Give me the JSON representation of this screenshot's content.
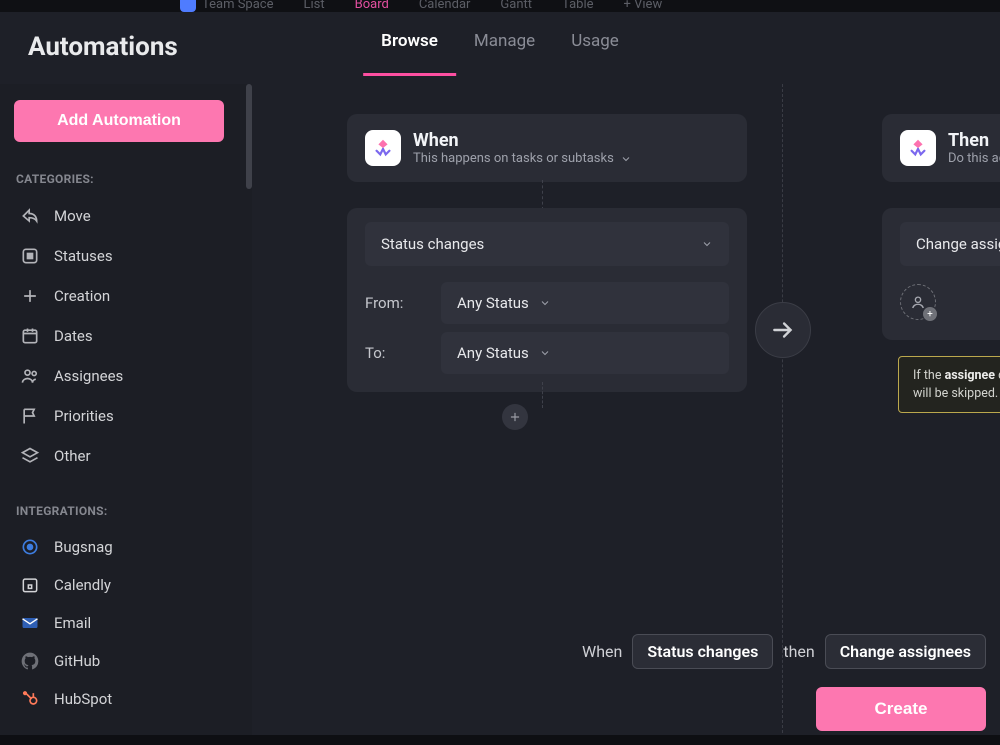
{
  "topbar": {
    "space": "Team Space",
    "views": [
      "List",
      "Board",
      "Calendar",
      "Gantt",
      "Table"
    ],
    "add_view": "+ View"
  },
  "page": {
    "title": "Automations"
  },
  "tabs": [
    {
      "label": "Browse",
      "active": true
    },
    {
      "label": "Manage",
      "active": false
    },
    {
      "label": "Usage",
      "active": false
    }
  ],
  "sidebar": {
    "add_label": "Add Automation",
    "categories_label": "CATEGORIES:",
    "categories": [
      {
        "label": "Move"
      },
      {
        "label": "Statuses"
      },
      {
        "label": "Creation"
      },
      {
        "label": "Dates"
      },
      {
        "label": "Assignees"
      },
      {
        "label": "Priorities"
      },
      {
        "label": "Other"
      }
    ],
    "integrations_label": "INTEGRATIONS:",
    "integrations": [
      {
        "label": "Bugsnag"
      },
      {
        "label": "Calendly"
      },
      {
        "label": "Email"
      },
      {
        "label": "GitHub"
      },
      {
        "label": "HubSpot"
      }
    ]
  },
  "builder": {
    "when": {
      "title": "When",
      "subtitle": "This happens on tasks or subtasks"
    },
    "then": {
      "title": "Then",
      "subtitle": "Do this action"
    },
    "trigger": {
      "type_label": "Status changes",
      "from_label": "From:",
      "from_value": "Any Status",
      "to_label": "To:",
      "to_value": "Any Status"
    },
    "action": {
      "type_label": "Change assignees"
    },
    "tooltip_prefix": "If the ",
    "tooltip_bold": "assignee",
    "tooltip_suffix_line1": " does not exist, this step",
    "tooltip_line2": "will be skipped."
  },
  "summary": {
    "when_word": "When",
    "when_chip": "Status changes",
    "then_word": "then",
    "then_chip": "Change assignees",
    "create_label": "Create"
  }
}
